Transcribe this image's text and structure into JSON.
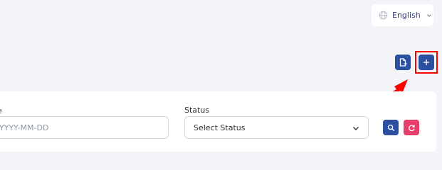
{
  "language": {
    "label": "English",
    "icon": "globe-icon"
  },
  "toolbar": {
    "export_icon": "document-export-icon",
    "add_icon": "plus-icon",
    "add_symbol": "+"
  },
  "filters": {
    "date_label": "e",
    "date_placeholder": "YYYY-MM-DD",
    "status_label": "Status",
    "status_value": "Select Status"
  },
  "colors": {
    "primary": "#2c4fa1",
    "danger": "#e83e6c",
    "highlight": "#ff0000"
  }
}
